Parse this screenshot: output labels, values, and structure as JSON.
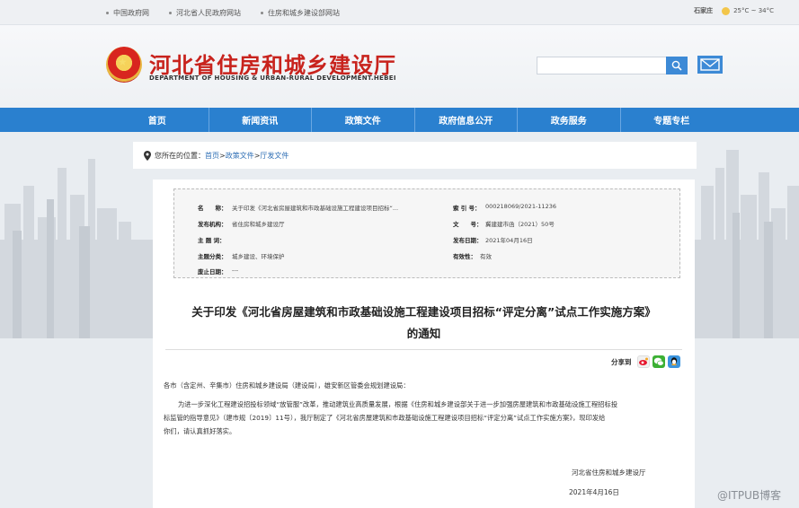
{
  "top_links": [
    "中国政府网",
    "河北省人民政府网站",
    "住房和城乡建设部网站"
  ],
  "weather": {
    "city": "石家庄",
    "temp": "25°C ~ 34°C"
  },
  "site": {
    "title": "河北省住房和城乡建设厅",
    "subtitle": "DEPARTMENT OF HOUSING & URBAN-RURAL DEVELOPMENT.HEBEI"
  },
  "search": {
    "placeholder": ""
  },
  "nav": [
    "首页",
    "新闻资讯",
    "政策文件",
    "政府信息公开",
    "政务服务",
    "专题专栏"
  ],
  "breadcrumb": {
    "label": "您所在的位置：",
    "items": [
      "首页",
      "政策文件",
      "厅发文件"
    ],
    "sep": ">"
  },
  "meta": {
    "name_label": "名　　称：",
    "name_value": "关于印发《河北省房屋建筑和市政基础设施工程建设项目招标“...",
    "index_label": "索 引 号：",
    "index_value": "000218069/2021-11236",
    "agency_label": "发布机构：",
    "agency_value": "省住房和城乡建设厅",
    "docno_label": "文　　号：",
    "docno_value": "冀建建市函（2021）50号",
    "subject_label": "主 题 词：",
    "subject_value": "",
    "date_label": "发布日期：",
    "date_value": "2021年04月16日",
    "category_label": "主题分类：",
    "category_value": "城乡建设、环境保护",
    "validity_label": "有效性：",
    "validity_value": "有效",
    "expire_label": "废止日期：",
    "expire_value": "---"
  },
  "doc": {
    "title_line1": "关于印发《河北省房屋建筑和市政基础设施工程建设项目招标“评定分离”试点工作实施方案》",
    "title_line2": "的通知",
    "share_label": "分享到",
    "salutation": "各市（含定州、辛集市）住房和城乡建设局（建设局），雄安新区管委会规划建设局：",
    "para1_line1": "为进一步深化工程建设招投标领域“放管服”改革，推动建筑业高质量发展，根据《住房和城乡建设部关于进一步加强房屋建筑和市政基础设施工程招标投",
    "para1_line2": "标监管的指导意见》（建市规〔2019〕11号），我厅制定了《河北省房屋建筑和市政基础设施工程建设项目招标“评定分离”试点工作实施方案》，现印发给",
    "para1_line3": "你们，请认真抓好落实。",
    "sign_org": "河北省住房和城乡建设厅",
    "sign_date": "2021年4月16日"
  },
  "watermark": "@ITPUB博客",
  "colors": {
    "nav_blue": "#2a80cf",
    "title_red": "#c8231d",
    "link_blue": "#2f6fb5"
  }
}
